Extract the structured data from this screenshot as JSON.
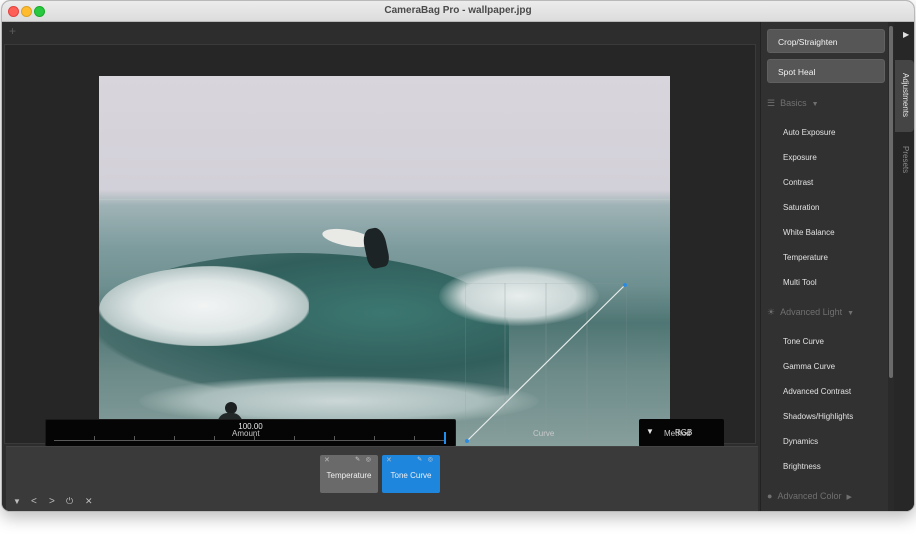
{
  "window": {
    "title": "CameraBag Pro - wallpaper.jpg"
  },
  "toolbar": {
    "add_glyph": "+"
  },
  "controls": {
    "amount": {
      "value": "100.00",
      "label": "Amount"
    },
    "curve": {
      "label": "Curve"
    },
    "method": {
      "value": "RGB",
      "label": "Method",
      "arrow_glyph": "▼"
    }
  },
  "adjustments_strip": {
    "tiles": [
      {
        "label": "Temperature",
        "active": false,
        "close_glyph": "✕",
        "icons": "✎ ◎"
      },
      {
        "label": "Tone Curve",
        "active": true,
        "close_glyph": "✕",
        "icons": "✎ ◎"
      }
    ]
  },
  "bottom_nav": {
    "collapse": "▼",
    "prev": "<",
    "next": ">",
    "power": "⏻",
    "clear": "✕"
  },
  "sidebar": {
    "crop_button": "Crop/Straighten",
    "heal_button": "Spot Heal",
    "basics": {
      "title": "Basics",
      "items": [
        "Auto Exposure",
        "Exposure",
        "Contrast",
        "Saturation",
        "White Balance",
        "Temperature",
        "Multi Tool"
      ]
    },
    "advanced_light": {
      "title": "Advanced Light",
      "items": [
        "Tone Curve",
        "Gamma Curve",
        "Advanced Contrast",
        "Shadows/Highlights",
        "Dynamics",
        "Brightness"
      ]
    },
    "advanced_color": {
      "title": "Advanced Color"
    }
  },
  "right_tabs": {
    "adjustments": "Adjustments",
    "presets": "Presets",
    "play_glyph": "▶"
  },
  "colors": {
    "accent": "#1f86dd",
    "tile_inactive": "#6a6a6a",
    "background": "#2d2d2d"
  }
}
